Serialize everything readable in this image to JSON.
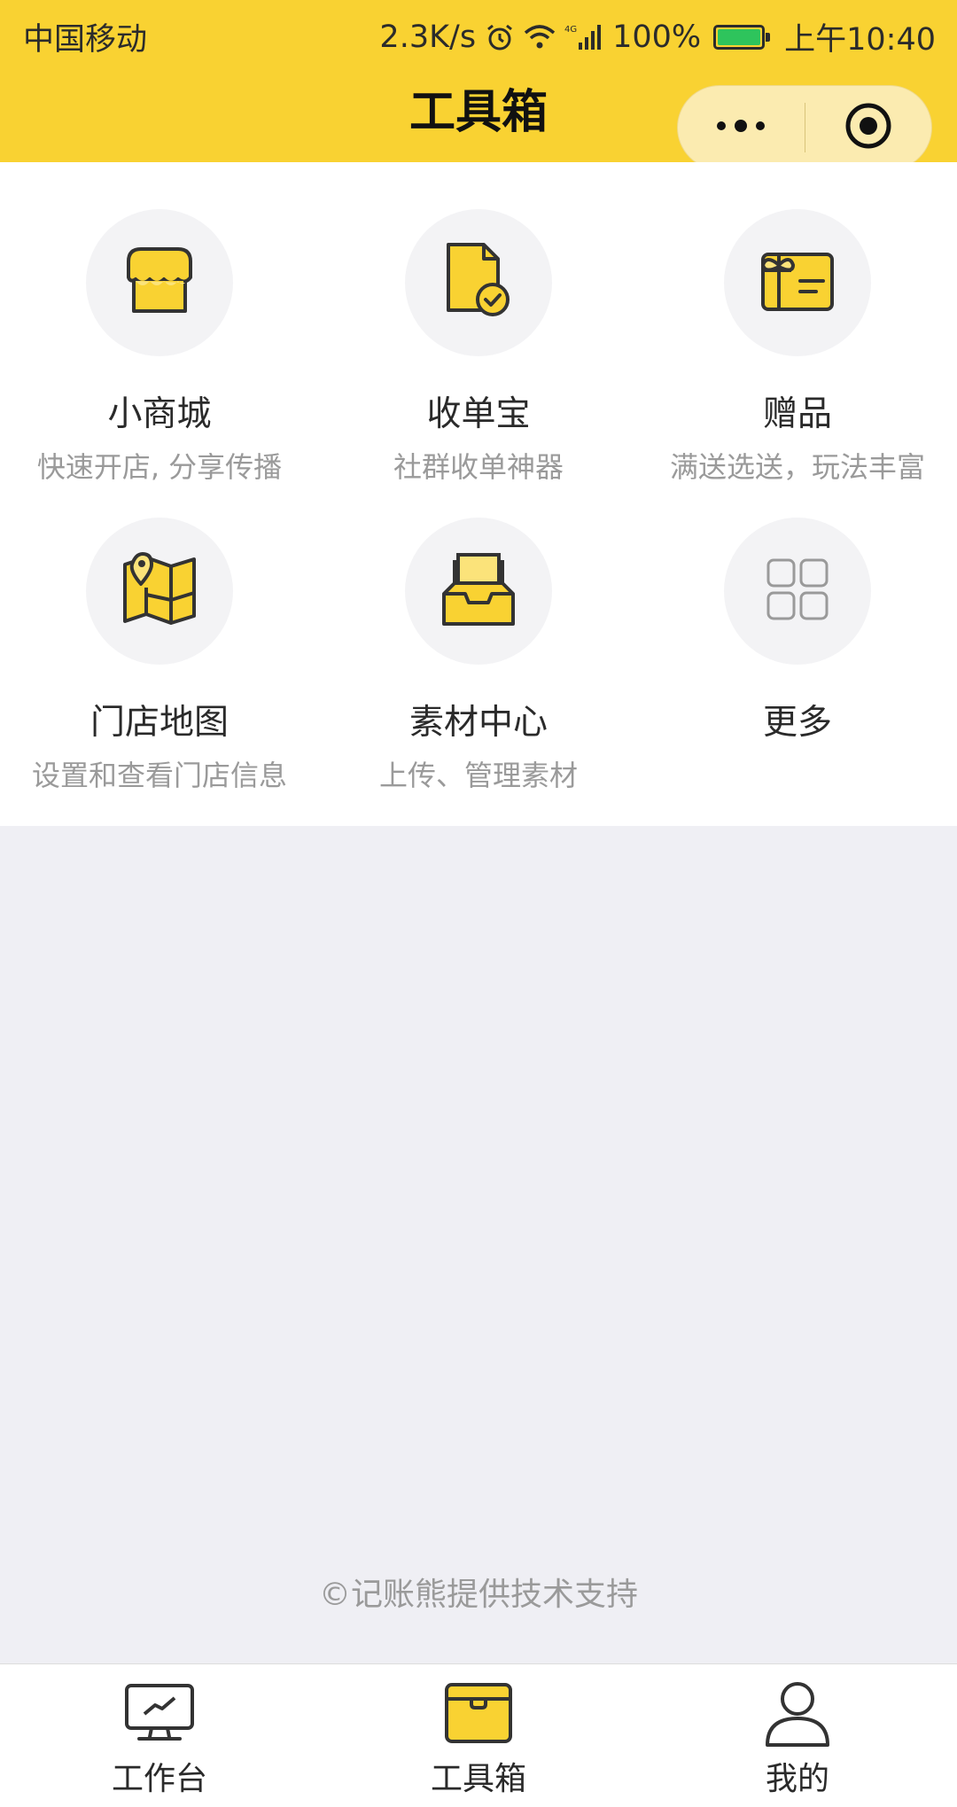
{
  "status_bar": {
    "carrier": "中国移动",
    "speed": "2.3K/s",
    "network": "4G",
    "battery": "100%",
    "time": "上午10:40"
  },
  "nav": {
    "title": "工具箱",
    "more_icon": "more-dots-icon",
    "close_icon": "target-icon"
  },
  "colors": {
    "brand_yellow": "#f9d232",
    "icon_yellow": "#f9d232",
    "icon_stroke": "#333333",
    "page_bg": "#efeff4"
  },
  "tools": [
    {
      "title": "小商城",
      "subtitle": "快速开店, 分享传播",
      "icon": "shop-icon"
    },
    {
      "title": "收单宝",
      "subtitle": "社群收单神器",
      "icon": "document-check-icon"
    },
    {
      "title": "赠品",
      "subtitle": "满送选送，玩法丰富",
      "icon": "gift-icon"
    },
    {
      "title": "门店地图",
      "subtitle": "设置和查看门店信息",
      "icon": "map-icon"
    },
    {
      "title": "素材中心",
      "subtitle": "上传、管理素材",
      "icon": "inbox-icon"
    },
    {
      "title": "更多",
      "subtitle": "",
      "icon": "grid-icon"
    }
  ],
  "footer": {
    "note": "©记账熊提供技术支持"
  },
  "tabbar": {
    "items": [
      {
        "label": "工作台",
        "icon": "monitor-icon",
        "active": false
      },
      {
        "label": "工具箱",
        "icon": "toolbox-icon",
        "active": true
      },
      {
        "label": "我的",
        "icon": "user-icon",
        "active": false
      }
    ]
  }
}
